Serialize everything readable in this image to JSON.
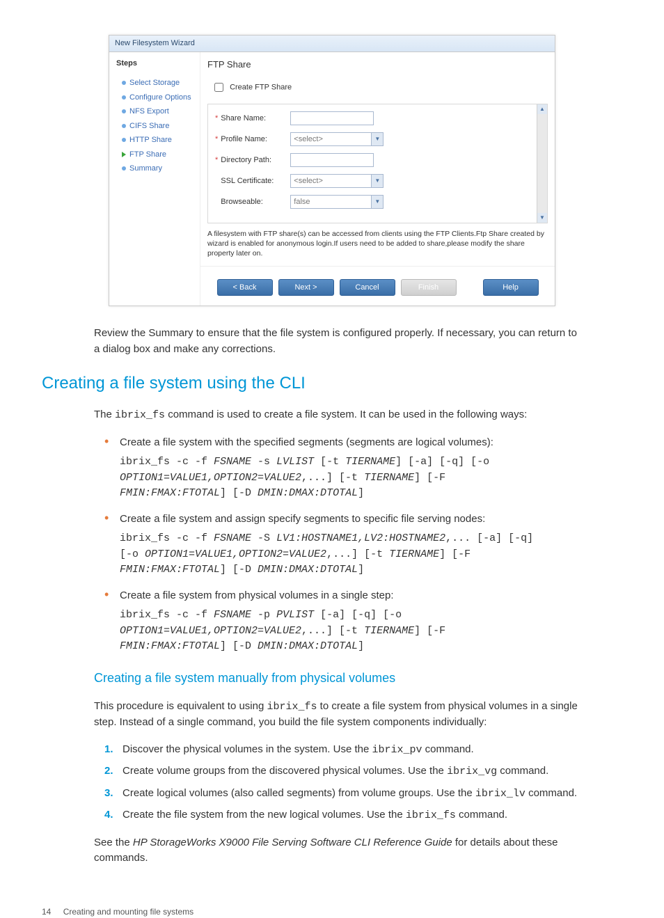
{
  "wizard": {
    "title": "New Filesystem Wizard",
    "steps_header": "Steps",
    "steps": [
      {
        "label": "Select Storage",
        "active": false
      },
      {
        "label": "Configure Options",
        "active": false
      },
      {
        "label": "NFS Export",
        "active": false
      },
      {
        "label": "CIFS Share",
        "active": false
      },
      {
        "label": "HTTP Share",
        "active": false
      },
      {
        "label": "FTP Share",
        "active": true
      },
      {
        "label": "Summary",
        "active": false
      }
    ],
    "panel_title": "FTP Share",
    "checkbox_label": "Create FTP Share",
    "fields": {
      "share_name": {
        "label": "Share Name:",
        "required": true,
        "value": ""
      },
      "profile_name": {
        "label": "Profile Name:",
        "required": true,
        "value": "<select>"
      },
      "directory_path": {
        "label": "Directory Path:",
        "required": true,
        "value": ""
      },
      "ssl_certificate": {
        "label": "SSL Certificate:",
        "required": false,
        "value": "<select>"
      },
      "browseable": {
        "label": "Browseable:",
        "required": false,
        "value": "false"
      }
    },
    "note": "A filesystem with FTP share(s) can be accessed from clients using the FTP Clients.Ftp Share created by wizard is enabled for anonymous login.If users need to be added to share,please modify the share property later on.",
    "buttons": {
      "back": "< Back",
      "next": "Next >",
      "cancel": "Cancel",
      "finish": "Finish",
      "help": "Help"
    }
  },
  "doc": {
    "para_review": "Review the Summary to ensure that the file system is configured properly. If necessary, you can return to a dialog box and make any corrections.",
    "section_title": "Creating a file system using the CLI",
    "intro_pre": "The ",
    "intro_cmd": "ibrix_fs",
    "intro_post": " command is used to create a file system. It can be used in the following ways:",
    "bullets": [
      {
        "lead": "Create a file system with the specified segments (segments are logical volumes):",
        "cmd_parts": [
          {
            "t": "ibrix_fs -c -f "
          },
          {
            "t": "FSNAME",
            "v": true
          },
          {
            "t": " -s "
          },
          {
            "t": "LVLIST",
            "v": true
          },
          {
            "t": " [-t "
          },
          {
            "t": "TIERNAME",
            "v": true
          },
          {
            "t": "] [-a] [-q] [-o\n"
          },
          {
            "t": "OPTION1=VALUE1,OPTION2=VALUE2",
            "v": true
          },
          {
            "t": ",...] [-t "
          },
          {
            "t": "TIERNAME",
            "v": true
          },
          {
            "t": "] [-F\n"
          },
          {
            "t": "FMIN:FMAX:FTOTAL",
            "v": true
          },
          {
            "t": "] [-D "
          },
          {
            "t": "DMIN:DMAX:DTOTAL",
            "v": true
          },
          {
            "t": "]"
          }
        ]
      },
      {
        "lead": "Create a file system and assign specify segments to specific file serving nodes:",
        "cmd_parts": [
          {
            "t": "ibrix_fs -c -f "
          },
          {
            "t": "FSNAME",
            "v": true
          },
          {
            "t": " -S "
          },
          {
            "t": "LV1:HOSTNAME1,LV2:HOSTNAME2",
            "v": true
          },
          {
            "t": ",... [-a] [-q]\n[-o "
          },
          {
            "t": "OPTION1=VALUE1,OPTION2=VALUE2",
            "v": true
          },
          {
            "t": ",...] [-t "
          },
          {
            "t": "TIERNAME",
            "v": true
          },
          {
            "t": "] [-F\n"
          },
          {
            "t": "FMIN:FMAX:FTOTAL",
            "v": true
          },
          {
            "t": "] [-D "
          },
          {
            "t": "DMIN:DMAX:DTOTAL",
            "v": true
          },
          {
            "t": "]"
          }
        ]
      },
      {
        "lead": "Create a file system from physical volumes in a single step:",
        "cmd_parts": [
          {
            "t": "ibrix_fs -c -f "
          },
          {
            "t": "FSNAME",
            "v": true
          },
          {
            "t": " -p "
          },
          {
            "t": "PVLIST",
            "v": true
          },
          {
            "t": " [-a] [-q] [-o\n"
          },
          {
            "t": "OPTION1=VALUE1,OPTION2=VALUE2",
            "v": true
          },
          {
            "t": ",...] [-t "
          },
          {
            "t": "TIERNAME",
            "v": true
          },
          {
            "t": "] [-F\n"
          },
          {
            "t": "FMIN:FMAX:FTOTAL",
            "v": true
          },
          {
            "t": "] [-D "
          },
          {
            "t": "DMIN:DMAX:DTOTAL",
            "v": true
          },
          {
            "t": "]"
          }
        ]
      }
    ],
    "subsection_title": "Creating a file system manually from physical volumes",
    "sub_intro_pre": "This procedure is equivalent to using ",
    "sub_intro_cmd": "ibrix_fs",
    "sub_intro_post": " to create a file system from physical volumes in a single step. Instead of a single command, you build the file system components individually:",
    "steps_list": [
      {
        "pre": "Discover the physical volumes in the system. Use the ",
        "cmd": "ibrix_pv",
        "post": " command."
      },
      {
        "pre": "Create volume groups from the discovered physical volumes. Use the ",
        "cmd": "ibrix_vg",
        "post": " command."
      },
      {
        "pre": "Create logical volumes (also called segments) from volume groups. Use the ",
        "cmd": "ibrix_lv",
        "post": " command."
      },
      {
        "pre": "Create the file system from the new logical volumes. Use the ",
        "cmd": "ibrix_fs",
        "post": " command."
      }
    ],
    "ref_pre": "See the ",
    "ref_title": "HP StorageWorks X9000 File Serving Software CLI Reference Guide",
    "ref_post": " for details about these commands.",
    "footer_page": "14",
    "footer_title": "Creating and mounting file systems"
  }
}
